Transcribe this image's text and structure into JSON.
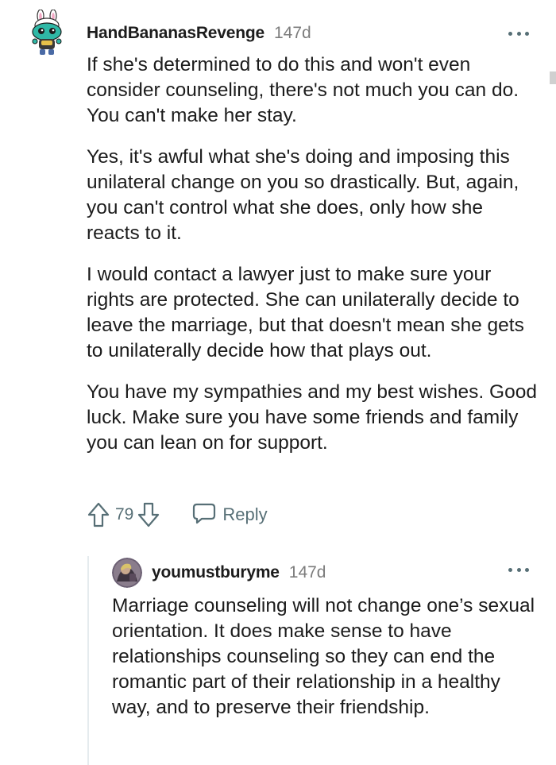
{
  "comment": {
    "username": "HandBananasRevenge",
    "age": "147d",
    "paragraphs": [
      "If she's determined to do this and won't even consider counseling, there's not much you can do. You can't make her stay.",
      "Yes, it's awful what she's doing and imposing this unilateral change on you so drastically. But, again, you can't control what she does, only how she reacts to it.",
      "I would contact a lawyer just to make sure your rights are protected. She can unilaterally decide to leave the marriage, but that doesn't mean she gets to unilaterally decide how that plays out.",
      "You have my sympathies and my best wishes. Good luck. Make sure you have some friends and family you can lean on for support."
    ],
    "vote_count": "79",
    "reply_label": "Reply",
    "avatar_icon": "snoo-bunny-avatar-icon",
    "upvote_icon": "upvote-arrow-icon",
    "downvote_icon": "downvote-arrow-icon",
    "reply_icon": "speech-bubble-icon",
    "more_icon": "more-options-icon"
  },
  "reply": {
    "username": "youmustburyme",
    "age": "147d",
    "text": "Marriage counseling will not change one’s sexual orientation. It does make sense to have relationships counseling so they can end the romantic part of their relationship in a healthy way, and to preserve their friendship.",
    "avatar_icon": "user-photo-avatar",
    "more_icon": "more-options-icon"
  },
  "colors": {
    "text": "#1c1c1c",
    "meta": "#7c7c7c",
    "icon": "#576f76",
    "thread_line": "#e5ebee"
  }
}
